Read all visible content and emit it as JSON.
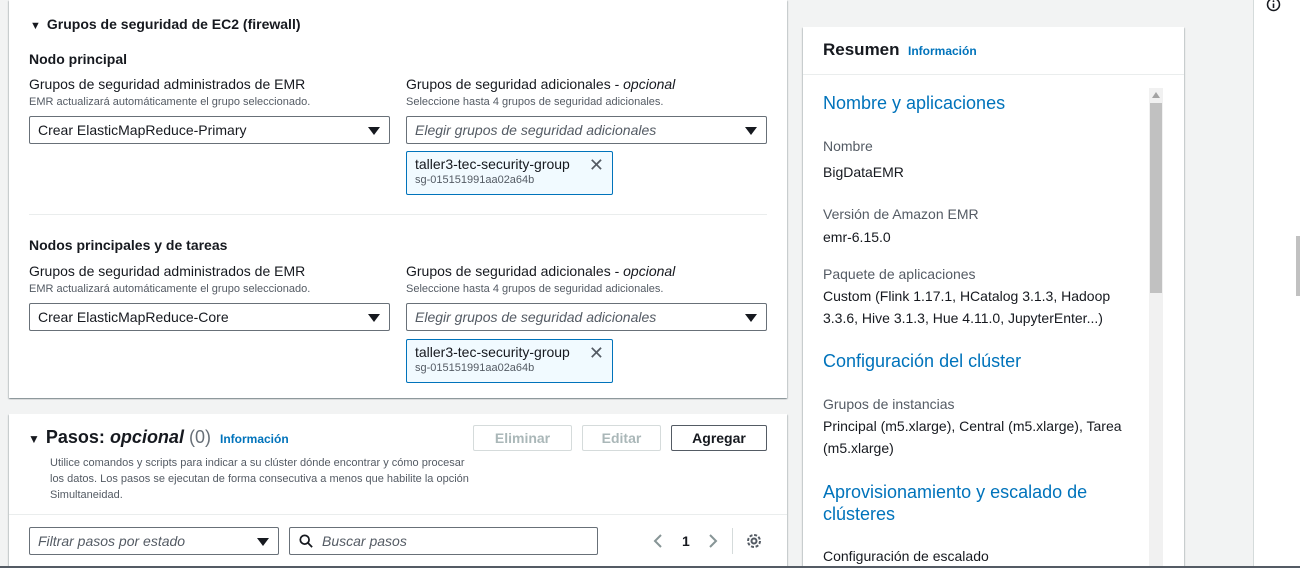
{
  "sg_section": {
    "title": "Grupos de seguridad de EC2 (firewall)",
    "groups": [
      {
        "heading": "Nodo principal",
        "managed_label": "Grupos de seguridad administrados de EMR",
        "managed_desc": "EMR actualizará automáticamente el grupo seleccionado.",
        "managed_value": "Crear ElasticMapReduce-Primary",
        "additional_label": "Grupos de seguridad adicionales -",
        "additional_optional": "opcional",
        "additional_desc": "Seleccione hasta 4 grupos de seguridad adicionales.",
        "additional_placeholder": "Elegir grupos de seguridad adicionales",
        "token_name": "taller3-tec-security-group",
        "token_id": "sg-015151991aa02a64b"
      },
      {
        "heading": "Nodos principales y de tareas",
        "managed_label": "Grupos de seguridad administrados de EMR",
        "managed_desc": "EMR actualizará automáticamente el grupo seleccionado.",
        "managed_value": "Crear ElasticMapReduce-Core",
        "additional_label": "Grupos de seguridad adicionales -",
        "additional_optional": "opcional",
        "additional_desc": "Seleccione hasta 4 grupos de seguridad adicionales.",
        "additional_placeholder": "Elegir grupos de seguridad adicionales",
        "token_name": "taller3-tec-security-group",
        "token_id": "sg-015151991aa02a64b"
      }
    ]
  },
  "steps": {
    "title": "Pasos:",
    "title_optional": "opcional",
    "count": "(0)",
    "info": "Información",
    "desc": "Utilice comandos y scripts para indicar a su clúster dónde encontrar y cómo procesar los datos. Los pasos se ejecutan de forma consecutiva a menos que habilite la opción Simultaneidad.",
    "buttons": {
      "delete": "Eliminar",
      "edit": "Editar",
      "add": "Agregar"
    },
    "filter_placeholder": "Filtrar pasos por estado",
    "search_placeholder": "Buscar pasos",
    "page": "1"
  },
  "summary": {
    "title": "Resumen",
    "info": "Información",
    "sections": {
      "names": "Nombre y aplicaciones",
      "cluster": "Configuración del clúster",
      "provisioning": "Aprovisionamiento y escalado de clústeres"
    },
    "fields": {
      "name_key": "Nombre",
      "name_val": "BigDataEMR",
      "version_key": "Versión de Amazon EMR",
      "version_val": "emr-6.15.0",
      "apps_key": "Paquete de aplicaciones",
      "apps_val": "Custom (Flink 1.17.1, HCatalog 3.1.3, Hadoop 3.3.6, Hive 3.1.3, Hue 4.11.0, JupyterEnter...)",
      "instances_key": "Grupos de instancias",
      "instances_val": "Principal (m5.xlarge), Central (m5.xlarge), Tarea (m5.xlarge)",
      "scaling_key": "Configuración de escalado"
    }
  },
  "icons": {
    "info_icon": "info-circle-icon",
    "gear": "gear-icon",
    "search": "search-icon"
  }
}
